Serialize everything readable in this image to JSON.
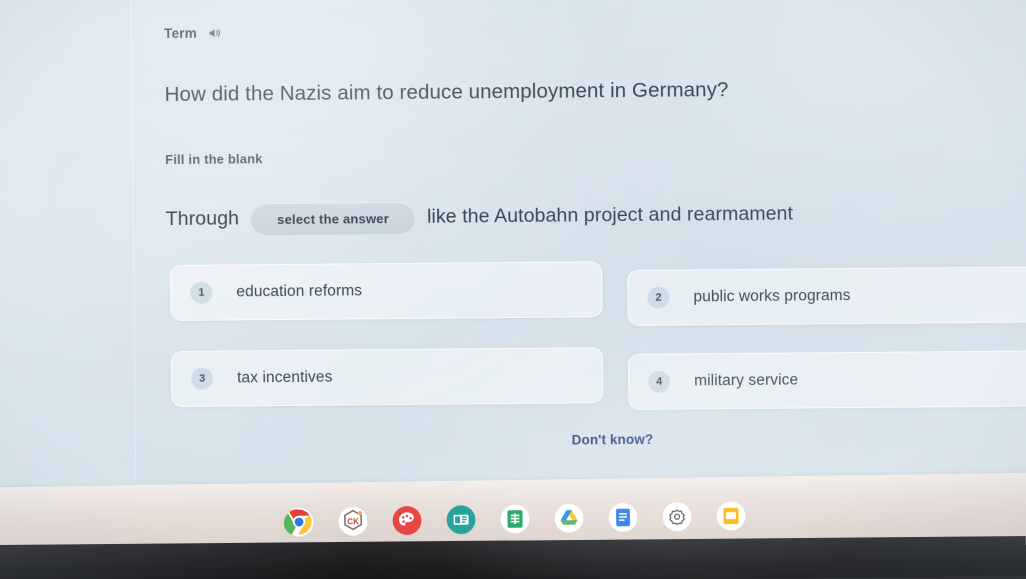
{
  "header": {
    "label": "Term",
    "audio_icon": "speaker-icon"
  },
  "question": {
    "text": "How did the Nazis aim to reduce unemployment in Germany?",
    "type_label": "Fill in the blank"
  },
  "sentence": {
    "prefix": "Through",
    "blank_placeholder": "select the answer",
    "suffix": "like the Autobahn project and rearmament"
  },
  "options": [
    {
      "number": "1",
      "label": "education reforms"
    },
    {
      "number": "2",
      "label": "public works programs"
    },
    {
      "number": "3",
      "label": "tax incentives"
    },
    {
      "number": "4",
      "label": "military service"
    }
  ],
  "actions": {
    "dont_know": "Don't know?"
  },
  "shelf": {
    "items": [
      {
        "name": "chrome-icon",
        "active": true
      },
      {
        "name": "ck-hexagon-icon",
        "active": false
      },
      {
        "name": "art-palette-icon",
        "active": false
      },
      {
        "name": "news-app-icon",
        "active": false
      },
      {
        "name": "google-sheets-icon",
        "active": false
      },
      {
        "name": "google-drive-icon",
        "active": false
      },
      {
        "name": "google-docs-icon",
        "active": false
      },
      {
        "name": "settings-gear-icon",
        "active": false
      },
      {
        "name": "google-slides-icon",
        "active": false
      }
    ]
  },
  "colors": {
    "screen_bg": "#d3e0e9",
    "text_primary": "#2c3945",
    "blank_pill": "#c9d4dc",
    "link": "#203c7a",
    "shelf_bg": "#e6dcd7"
  }
}
